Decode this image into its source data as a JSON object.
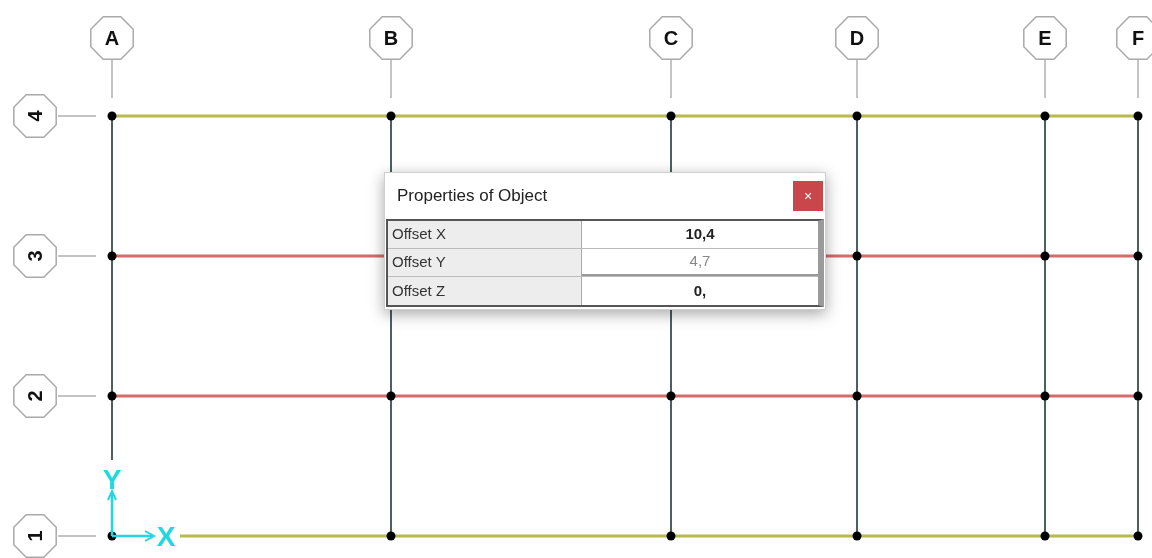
{
  "grid_columns": [
    {
      "label": "A"
    },
    {
      "label": "B"
    },
    {
      "label": "C"
    },
    {
      "label": "D"
    },
    {
      "label": "E"
    },
    {
      "label": "F"
    }
  ],
  "grid_rows": [
    {
      "label": "4",
      "color": "#b8ba4c"
    },
    {
      "label": "3",
      "color": "#d46a6a"
    },
    {
      "label": "2",
      "color": "#d46a6a"
    },
    {
      "label": "1",
      "color": "#b8ba4c"
    }
  ],
  "axes": [
    {
      "label": "X"
    },
    {
      "label": "Y"
    }
  ],
  "dialog": {
    "title": "Properties of Object",
    "close": "×",
    "properties": [
      {
        "name": "Offset X",
        "value": "10,4",
        "editing": false
      },
      {
        "name": "Offset Y",
        "value": "4,7",
        "editing": true
      },
      {
        "name": "Offset Z",
        "value": "0,",
        "editing": false
      }
    ]
  }
}
